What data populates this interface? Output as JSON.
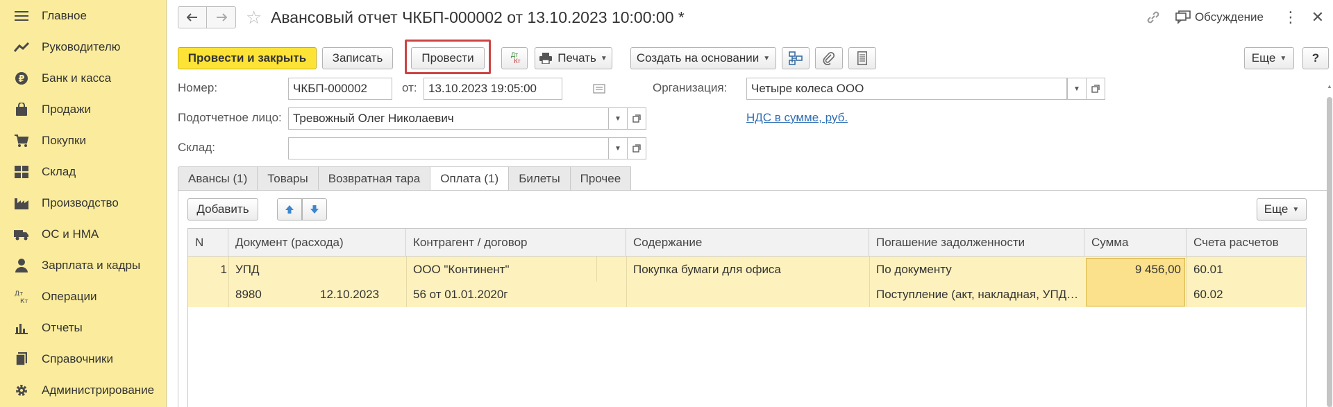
{
  "sidebar": {
    "items": [
      {
        "label": "Главное",
        "icon": "menu-icon"
      },
      {
        "label": "Руководителю",
        "icon": "trend-icon"
      },
      {
        "label": "Банк и касса",
        "icon": "ruble-coin-icon"
      },
      {
        "label": "Продажи",
        "icon": "shopping-bag-icon"
      },
      {
        "label": "Покупки",
        "icon": "cart-icon"
      },
      {
        "label": "Склад",
        "icon": "warehouse-icon"
      },
      {
        "label": "Производство",
        "icon": "factory-icon"
      },
      {
        "label": "ОС и НМА",
        "icon": "truck-icon"
      },
      {
        "label": "Зарплата и кадры",
        "icon": "person-icon"
      },
      {
        "label": "Операции",
        "icon": "dt-kt-icon"
      },
      {
        "label": "Отчеты",
        "icon": "bar-chart-icon"
      },
      {
        "label": "Справочники",
        "icon": "books-icon"
      },
      {
        "label": "Администрирование",
        "icon": "gear-icon"
      }
    ]
  },
  "header": {
    "title": "Авансовый отчет ЧКБП-000002 от 13.10.2023 10:00:00 *",
    "discuss_label": "Обсуждение"
  },
  "toolbar": {
    "post_close": "Провести и закрыть",
    "save": "Записать",
    "post": "Провести",
    "dtkt_top": "Дт",
    "dtkt_bottom": "Кт",
    "print": "Печать",
    "create_based": "Создать на основании",
    "more": "Еще",
    "help": "?"
  },
  "form": {
    "number_label": "Номер:",
    "number_value": "ЧКБП-000002",
    "date_label": "от:",
    "date_value": "13.10.2023 19:05:00",
    "org_label": "Организация:",
    "org_value": "Четыре колеса ООО",
    "person_label": "Подотчетное лицо:",
    "person_value": "Тревожный Олег Николаевич",
    "vat_link": "НДС в сумме, руб.",
    "warehouse_label": "Склад:",
    "warehouse_value": ""
  },
  "tabs": [
    {
      "label": "Авансы (1)",
      "active": false
    },
    {
      "label": "Товары",
      "active": false
    },
    {
      "label": "Возвратная тара",
      "active": false
    },
    {
      "label": "Оплата (1)",
      "active": true
    },
    {
      "label": "Билеты",
      "active": false
    },
    {
      "label": "Прочее",
      "active": false
    }
  ],
  "table_toolbar": {
    "add": "Добавить",
    "more": "Еще"
  },
  "table": {
    "columns": [
      "N",
      "Документ (расхода)",
      "Контрагент / договор",
      "Содержание",
      "Погашение задолженности",
      "Сумма",
      "Счета расчетов"
    ],
    "rows": [
      {
        "n": "1",
        "doc_type": "УПД",
        "doc_number": "8980",
        "doc_date": "12.10.2023",
        "counterparty": "ООО \"Континент\"",
        "contract": "56 от 01.01.2020г",
        "content": "Покупка бумаги для офиса",
        "repayment": "По документу",
        "repayment_doc": "Поступление (акт, накладная, УПД…",
        "sum": "9 456,00",
        "account1": "60.01",
        "account2": "60.02"
      }
    ]
  },
  "colors": {
    "sidebar_bg": "#fbec9d",
    "primary_button": "#fde335",
    "row_highlight": "#fdf1bd",
    "highlight_border": "#cc4444",
    "link": "#2f6fb7"
  }
}
